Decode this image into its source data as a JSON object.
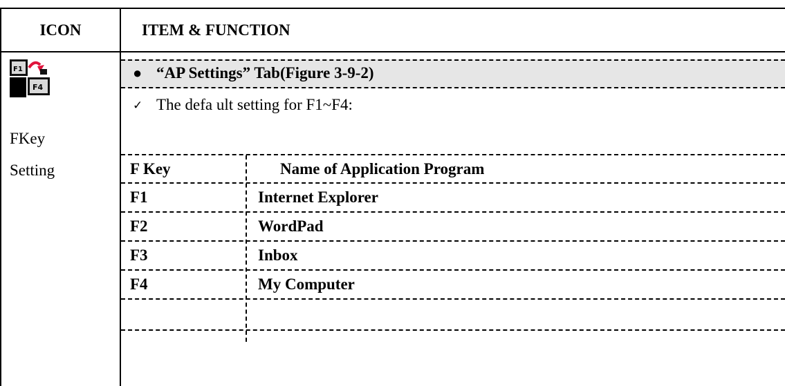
{
  "header": {
    "icon_col": "ICON",
    "item_col": "ITEM & FUNCTION"
  },
  "item": {
    "icon_name": "fkey-setting-icon",
    "label_line1": "FKey",
    "label_line2": "Setting"
  },
  "section": {
    "bullet": "●",
    "title": "“AP Settings” Tab(Figure 3-9-2)",
    "check": "✓",
    "default_text": "The defa ult setting for F1~F4:"
  },
  "table": {
    "headers": [
      "F Key",
      "Name of Application Program"
    ],
    "rows": [
      {
        "key": "F1",
        "program": "Internet Explorer"
      },
      {
        "key": "F2",
        "program": "WordPad"
      },
      {
        "key": "F3",
        "program": "Inbox"
      },
      {
        "key": "F4",
        "program": "My Computer"
      }
    ]
  }
}
